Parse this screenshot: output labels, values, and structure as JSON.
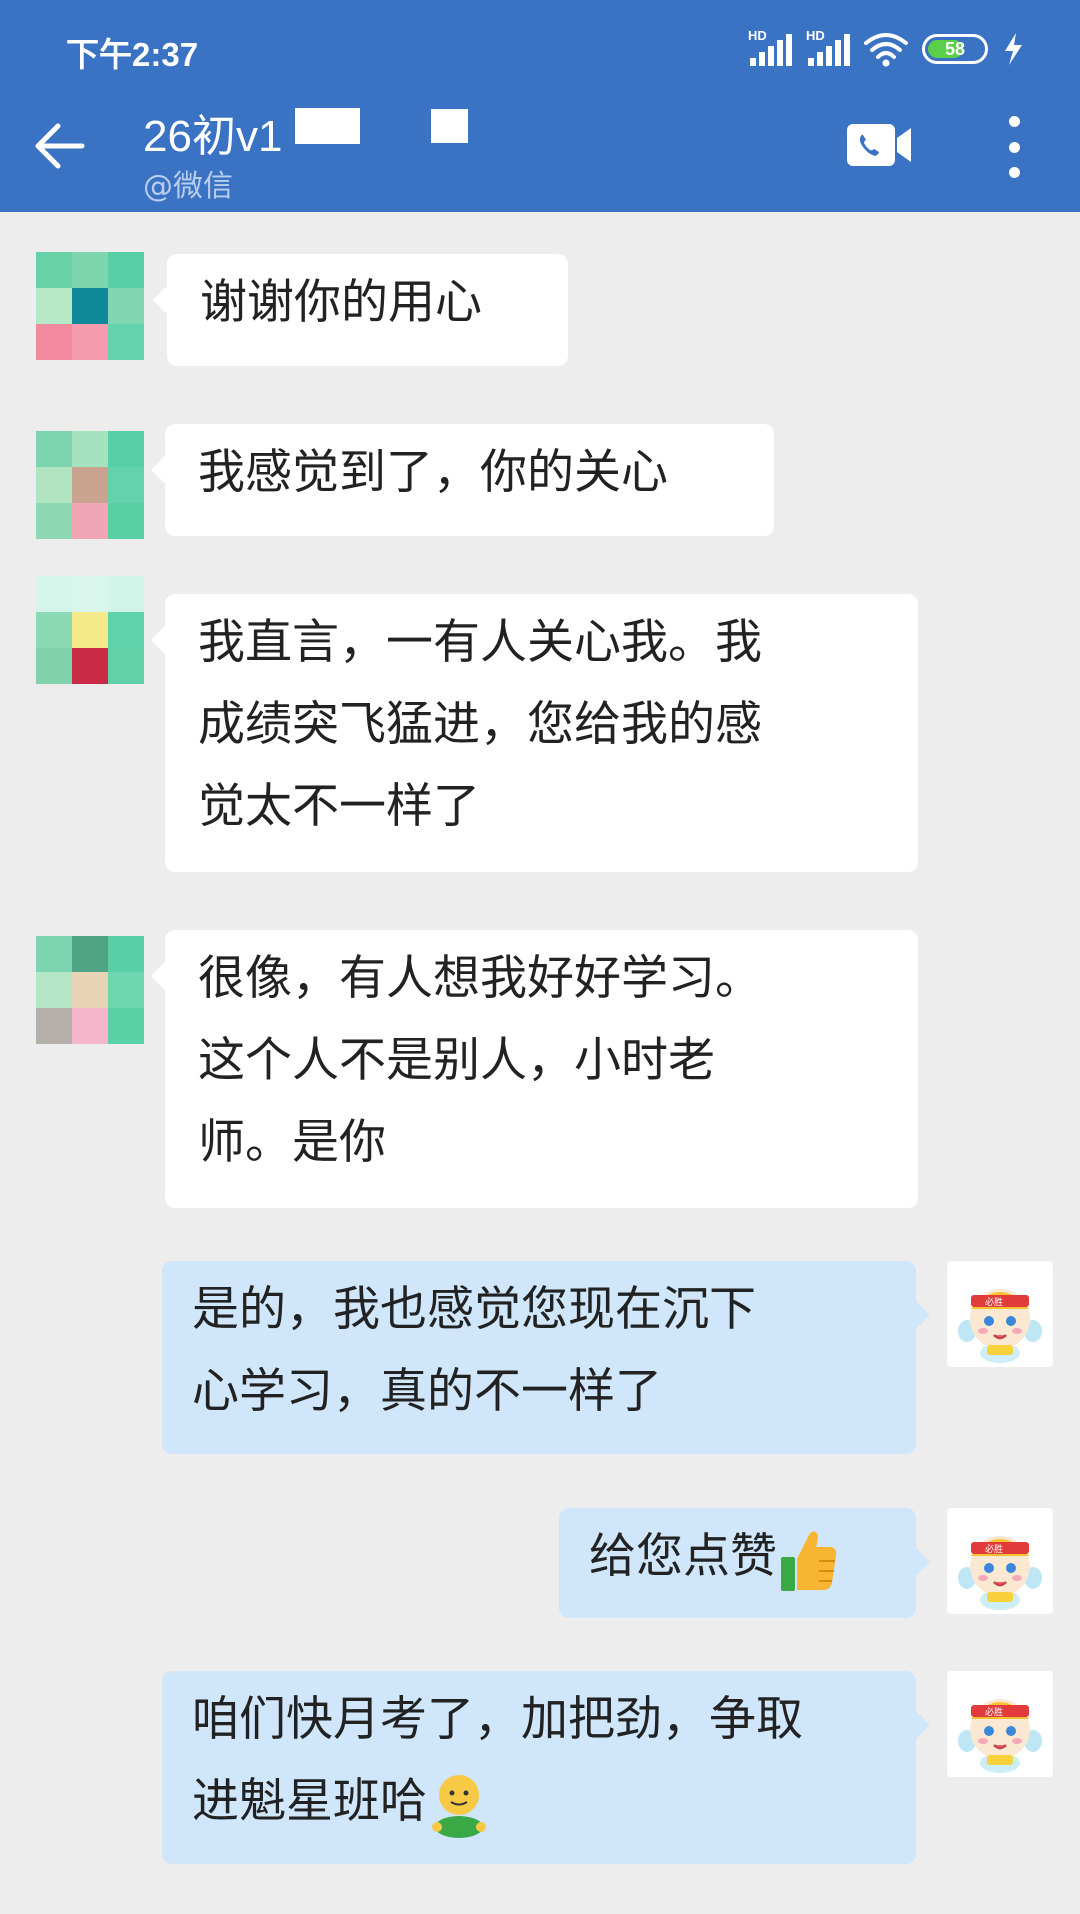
{
  "status_bar": {
    "time": "下午2:37",
    "network_label_1": "HD",
    "network_label_2": "HD",
    "battery": "58"
  },
  "header": {
    "title": "26初v1",
    "subtitle": "@微信",
    "icons": [
      "back-arrow-icon",
      "video-call-icon",
      "more-options-icon"
    ]
  },
  "messages": [
    {
      "side": "in",
      "lines": [
        "谢谢你的用心"
      ]
    },
    {
      "side": "in",
      "lines": [
        "我感觉到了，你的关心"
      ]
    },
    {
      "side": "in",
      "lines": [
        "我直言，一有人关心我。我",
        "成绩突飞猛进，您给我的感",
        "觉太不一样了"
      ]
    },
    {
      "side": "in",
      "lines": [
        "很像，有人想我好好学习。",
        "这个人不是别人，小时老",
        "师。是你"
      ]
    },
    {
      "side": "out",
      "lines": [
        "是的，我也感觉您现在沉下",
        "心学习，真的不一样了"
      ]
    },
    {
      "side": "out",
      "lines": [
        "给您点赞"
      ],
      "emoji": "thumbs-up"
    },
    {
      "side": "out",
      "lines": [
        "咱们快月考了，加把劲，争取",
        "进魁星班哈"
      ],
      "emoji": "smiling-figure"
    }
  ],
  "avatar_sticker_text": "必胜",
  "colors": {
    "header_bg": "#3a72c4",
    "chat_bg": "#ededed",
    "incoming_bubble": "#ffffff",
    "outgoing_bubble": "#cfe6fb"
  }
}
